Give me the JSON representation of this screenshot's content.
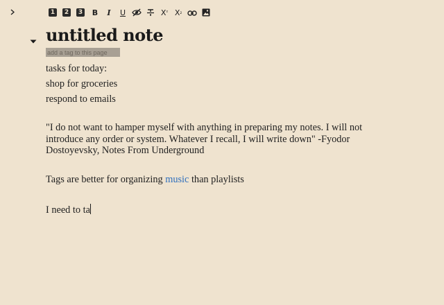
{
  "sidebar": {
    "toggle_icon": "chevron-right-icon"
  },
  "toolbar": {
    "heading1_label": "1",
    "heading2_label": "2",
    "heading3_label": "3",
    "bold_label": "B",
    "italic_label": "I",
    "underline_label": "U",
    "hide_icon": "eye-off-icon",
    "strike_icon": "strikethrough-icon",
    "superscript_label": "X",
    "superscript_mark": "²",
    "subscript_label": "X",
    "subscript_mark": "₂",
    "link_icon": "link-icon",
    "image_icon": "image-icon"
  },
  "note": {
    "title": "untitled note",
    "tag_placeholder": "add a tag to this page",
    "lines": [
      "tasks for today:",
      "shop for groceries",
      "respond to emails"
    ],
    "quote": "\"I do not want to hamper myself with anything in preparing my notes. I will not introduce any order or system. Whatever I recall, I will write down\" -Fyodor Dostoyevsky, Notes From Underground",
    "tags_sentence": {
      "before": "Tags are better for organizing ",
      "link": "music",
      "after": " than playlists"
    },
    "typing_line": "I need to ta"
  },
  "colors": {
    "background": "#efe3cf",
    "link": "#2e6fbd",
    "tag_field": "#a8a094"
  }
}
